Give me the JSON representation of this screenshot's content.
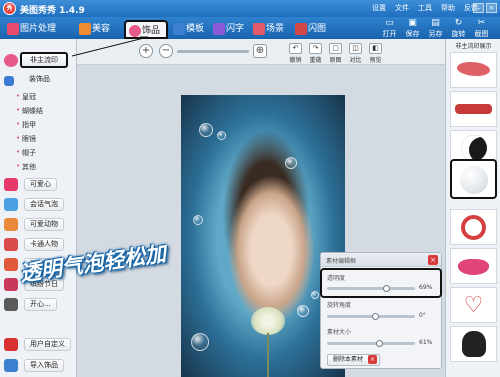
{
  "app": {
    "title": "美图秀秀 1.4.9",
    "logo_text": "秀",
    "menus": [
      "设置",
      "文件",
      "工具",
      "帮助",
      "反馈"
    ]
  },
  "tabs": [
    {
      "label": "图片处理",
      "icon": "picture-icon",
      "color": "#e94b6d"
    },
    {
      "label": "美容",
      "icon": "beauty-icon",
      "color": "#f08a33"
    },
    {
      "label": "饰品",
      "icon": "lips-icon",
      "color": "#e85a8a",
      "active": true
    },
    {
      "label": "模板",
      "icon": "grid-icon",
      "color": "#3b7fd0"
    },
    {
      "label": "闪字",
      "icon": "flash-text-icon",
      "color": "#8b5ad6"
    },
    {
      "label": "场景",
      "icon": "scene-icon",
      "color": "#e25a6a"
    },
    {
      "label": "闪图",
      "icon": "flash-image-icon",
      "color": "#d24848"
    }
  ],
  "toolbar_right": [
    {
      "label": "打开",
      "icon": "open-icon"
    },
    {
      "label": "保存",
      "icon": "save-icon"
    },
    {
      "label": "另存",
      "icon": "save-as-icon"
    },
    {
      "label": "旋转",
      "icon": "rotate-icon"
    },
    {
      "label": "截图",
      "icon": "screenshot-icon"
    }
  ],
  "left_panel": {
    "categories": [
      {
        "label": "非主流印",
        "icon": "stamp-icon",
        "color": "#e85a8a"
      },
      {
        "label": "装饰品",
        "icon": "decor-icon",
        "color": "#3c7bd1"
      },
      {
        "label": "可爱心",
        "icon": "heart-icon",
        "color": "#e53a6a"
      },
      {
        "label": "会话气泡",
        "icon": "speech-bubble-icon",
        "color": "#4aa0e0"
      },
      {
        "label": "可爱动物",
        "icon": "animal-icon",
        "color": "#e88a3a"
      },
      {
        "label": "卡通人物",
        "icon": "cartoon-icon",
        "color": "#d94a4a"
      },
      {
        "label": "动态文字",
        "icon": "animated-text-icon",
        "color": "#e05a3a"
      },
      {
        "label": "缤纷节日",
        "icon": "festival-icon",
        "color": "#c93a5a"
      },
      {
        "label": "开心...",
        "icon": "happy-icon",
        "color": "#5a5a5a"
      },
      {
        "label": "用户自定义",
        "icon": "user-custom-icon",
        "color": "#d83030"
      },
      {
        "label": "导入饰品",
        "icon": "import-icon",
        "color": "#3b7fd0"
      }
    ],
    "subitems": [
      "皇冠",
      "蝴蝶结",
      "指甲",
      "眼镜",
      "帽子",
      "其他"
    ]
  },
  "main_toolbar": {
    "zoom_in": "+",
    "zoom_out": "−",
    "actions": [
      {
        "label": "撤销",
        "icon": "undo-icon"
      },
      {
        "label": "重做",
        "icon": "redo-icon"
      },
      {
        "label": "原图",
        "icon": "original-icon"
      },
      {
        "label": "对比",
        "icon": "compare-icon"
      },
      {
        "label": "预览",
        "icon": "preview-icon"
      }
    ]
  },
  "banner_text": "透明气泡轻松加",
  "adjust_panel": {
    "title": "素材编辑框",
    "sliders": [
      {
        "label": "透明度",
        "value_text": "69%",
        "value": 0.69
      },
      {
        "label": "旋转角度",
        "value_text": "0°",
        "value": 0.0
      },
      {
        "label": "素材大小",
        "value_text": "61%",
        "value": 0.61
      }
    ],
    "delete_label": "删除本素材"
  },
  "right_panel": {
    "title": "非主流印展示",
    "thumbnails": [
      {
        "name": "red-sparkle-thumb",
        "color": "#d8464a"
      },
      {
        "name": "red-text-thumb",
        "color": "#c83a3a"
      },
      {
        "name": "moon-thumb",
        "color": "#1a1a1a"
      },
      {
        "name": "bubble-thumb",
        "color": "#e4e8ec",
        "selected": true
      },
      {
        "name": "peace-sign-thumb",
        "color": "#d43f3f"
      },
      {
        "name": "lips-thumb",
        "color": "#e0457a"
      },
      {
        "name": "heart-thumb",
        "color": "#d8464a"
      },
      {
        "name": "skull-thumb",
        "color": "#222222"
      }
    ]
  }
}
